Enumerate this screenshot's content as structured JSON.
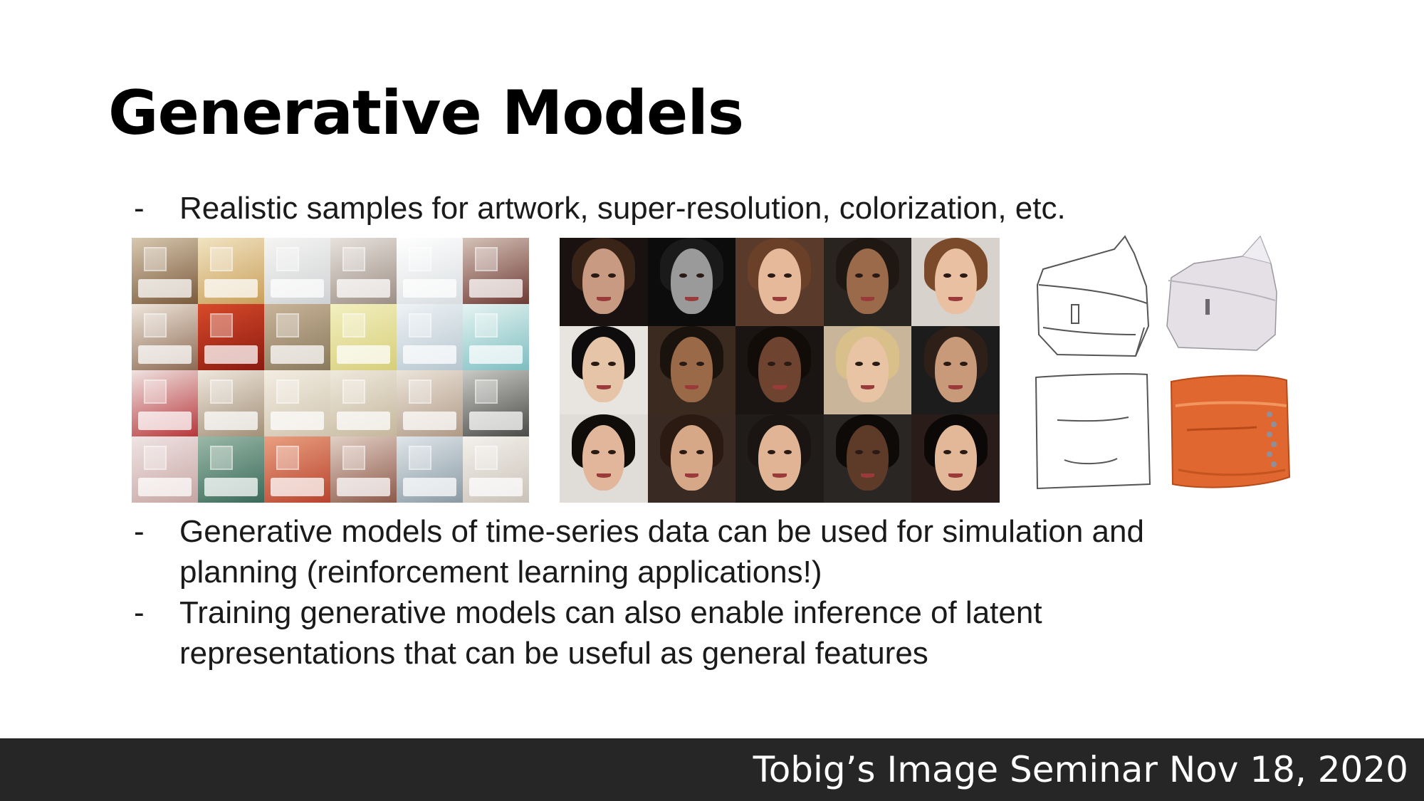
{
  "slide": {
    "title": "Generative Models",
    "bullets": [
      {
        "dash": "-",
        "lines": [
          "Realistic samples for artwork, super-resolution, colorization, etc."
        ]
      },
      {
        "dash": "-",
        "lines": [
          "Generative models of time-series data can be used for simulation and",
          "planning (reinforcement learning applications!)"
        ]
      },
      {
        "dash": "-",
        "lines": [
          "Training generative models can also enable inference of  latent",
          "representations that can be useful as general features"
        ]
      }
    ],
    "figures": {
      "bedrooms_label": "generated bedroom samples",
      "faces_label": "generated face samples",
      "bags_label": "sketch to handbag samples"
    }
  },
  "footer": {
    "text": "Tobig’s Image Seminar Nov 18, 2020"
  },
  "colors": {
    "footer_background": "#262626",
    "footer_text": "#ffffff",
    "bag_orange": "#e0672f"
  }
}
